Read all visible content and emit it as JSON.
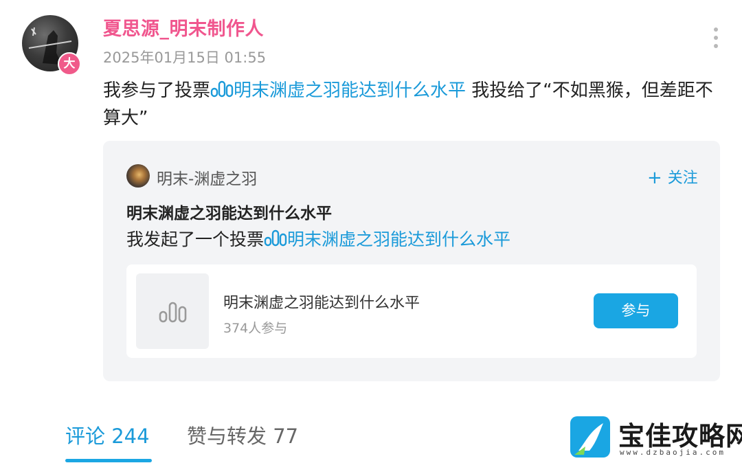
{
  "post": {
    "username": "夏思源_明末制作人",
    "avatar_badge": "大",
    "time": "2025年01月15日 01:55",
    "text_prefix": "我参与了投票",
    "text_link": "明末渊虚之羽能达到什么水平",
    "text_suffix": " 我投给了“不如黑猴，但差距不算大”"
  },
  "card": {
    "author": "明末-渊虚之羽",
    "follow_label": "关注",
    "title": "明末渊虚之羽能达到什么水平",
    "desc_prefix": "我发起了一个投票",
    "desc_link": "明末渊虚之羽能达到什么水平",
    "vote": {
      "name": "明末渊虚之羽能达到什么水平",
      "participants": "374人参与",
      "join_label": "参与"
    }
  },
  "tabs": [
    {
      "label": "评论 244",
      "active": true
    },
    {
      "label": "赞与转发 77",
      "active": false
    }
  ],
  "watermark": {
    "title": "宝佳攻略网",
    "url": "www.dzbaojia.com"
  },
  "icons": {
    "vote": "vote-bars-icon",
    "more": "more-vertical-icon",
    "follow": "plus-icon"
  },
  "colors": {
    "username": "#f0568e",
    "link": "#1a9ad9",
    "button": "#1aa6e3"
  }
}
